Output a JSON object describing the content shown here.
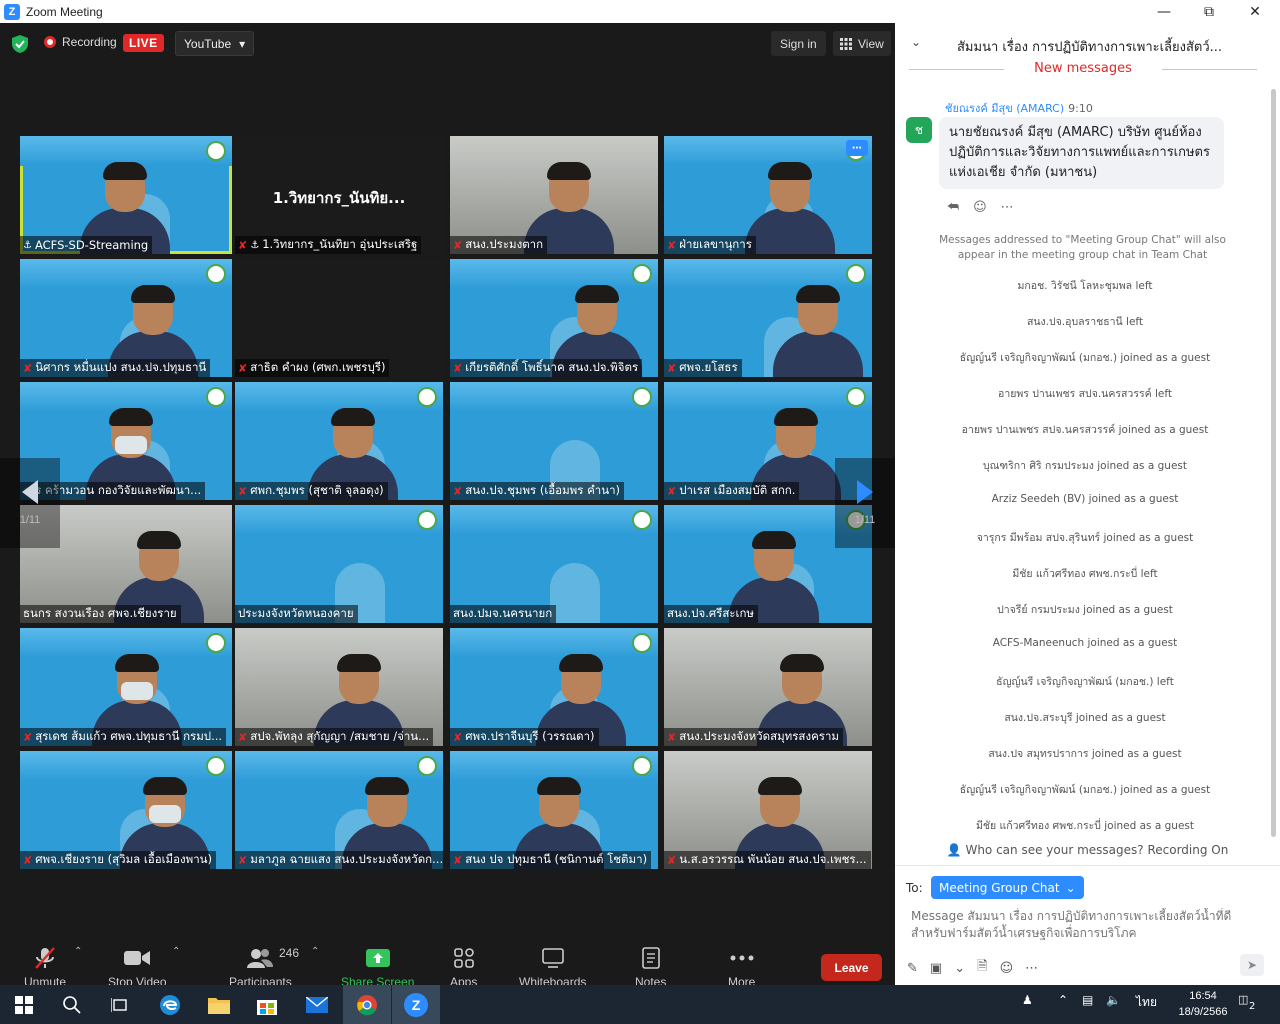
{
  "window": {
    "title": "Zoom Meeting"
  },
  "topbar": {
    "recording_label": "Recording",
    "live_label": "LIVE",
    "stream_target": "YouTube",
    "sign_in_label": "Sign in",
    "view_label": "View"
  },
  "gallery": {
    "page_left": "1/11",
    "page_right": "1/11",
    "tiles": [
      {
        "name": "ACFS-SD-Streaming",
        "muted": false,
        "pinned": true,
        "active": true,
        "kind": "slide"
      },
      {
        "name": "1.วิทยากร_นันทิยา อุ่นประเสริฐ",
        "display_name": "1.วิทยากร_นันทิย...",
        "muted": true,
        "pinned": true,
        "kind": "dark"
      },
      {
        "name": "สนง.ประมงตาก",
        "muted": true,
        "kind": "camera"
      },
      {
        "name": "ฝ่ายเลขานุการ",
        "muted": true,
        "kind": "slide"
      },
      {
        "name": "นิศากร หมื่นแปง สนง.ปจ.ปทุมธานี",
        "muted": true,
        "kind": "slide"
      },
      {
        "name": "สาธิต คำผง (ศพก.เพชรบุรี)",
        "muted": true,
        "kind": "dark"
      },
      {
        "name": "เกียรติศักดิ์ โพธิ์นาค สนง.ปจ.พิจิตร",
        "muted": true,
        "kind": "slide"
      },
      {
        "name": "ศพจ.ยโสธร",
        "muted": true,
        "kind": "slide"
      },
      {
        "name": "ร คร้ามวอน กองวิจัยและพัฒนา...",
        "muted": true,
        "kind": "slide"
      },
      {
        "name": "ศพก.ชุมพร (สุชาติ จุลอดุง)",
        "muted": true,
        "kind": "slide"
      },
      {
        "name": "สนง.ปจ.ชุมพร (เอื้อมพร คำนา)",
        "muted": true,
        "kind": "slide"
      },
      {
        "name": "ปาเรส เมืองสมบัติ สกก.",
        "muted": true,
        "kind": "slide"
      },
      {
        "name": "ธนกร สงวนเรือง ศพจ.เชียงราย",
        "muted": false,
        "kind": "camera"
      },
      {
        "name": "ประมงจังหวัดหนองคาย",
        "muted": false,
        "kind": "slide"
      },
      {
        "name": "สนง.ปมจ.นครนายก",
        "muted": false,
        "kind": "slide"
      },
      {
        "name": "สนง.ปจ.ศรีสะเกษ",
        "muted": false,
        "kind": "slide"
      },
      {
        "name": "สุรเดช ส้มแก้ว ศพจ.ปทุมธานี กรมป...",
        "muted": true,
        "kind": "slide"
      },
      {
        "name": "สปจ.พัทลุง สุกัญญา /สมชาย /จ่าน...",
        "muted": true,
        "kind": "camera"
      },
      {
        "name": "ศพจ.ปราจีนบุรี (วรรณดา)",
        "muted": true,
        "kind": "slide"
      },
      {
        "name": "สนง.ประมงจังหวัดสมุทรสงคราม",
        "muted": true,
        "kind": "camera"
      },
      {
        "name": "ศพจ.เชียงราย (สุวิมล เอื้อเมืองพาน)",
        "muted": true,
        "kind": "slide"
      },
      {
        "name": "มลาภูล ฉายแสง สนง.ประมงจังหวัดก...",
        "muted": true,
        "kind": "slide"
      },
      {
        "name": "สนง ปจ ปทุมธานี (ชนิกานต์ โชติมา)",
        "muted": true,
        "kind": "slide"
      },
      {
        "name": "น.ส.อรวรรณ พันน้อย สนง.ปจ.เพชร...",
        "muted": true,
        "kind": "camera"
      }
    ]
  },
  "toolbar": {
    "unmute": "Unmute",
    "stop_video": "Stop Video",
    "participants": "Participants",
    "participants_count": "246",
    "share_screen": "Share Screen",
    "apps": "Apps",
    "whiteboards": "Whiteboards",
    "notes": "Notes",
    "more": "More",
    "leave": "Leave"
  },
  "chat": {
    "title": "สัมมนา เรื่อง การปฏิบัติทางการเพาะเลี้ยงสัตว์...",
    "new_messages": "New messages",
    "message": {
      "sender": "ชัยณรงค์ มีสุข (AMARC)",
      "time": "9:10",
      "avatar_letter": "ช",
      "text": "นายชัยณรงค์ มีสุข (AMARC) บริษัท ศูนย์ห้องปฏิบัติการและวิจัยทางการแพทย์และการเกษตรแห่งเอเชีย จำกัด (มหาชน)"
    },
    "notice": "Messages addressed to \"Meeting Group Chat\" will also appear in the meeting group chat in Team Chat",
    "events": [
      "มกอช. วิรัชนี โลหะชุมพล left",
      "สนง.ปจ.อุบลราชธานี left",
      "ธัญญ์นรี เจริญกิจญาพัฒน์ (มกอช.) joined as a guest",
      "อายพร ปานเพชร สปจ.นครสวรรค์ left",
      "อายพร ปานเพชร สปจ.นครสวรรค์ joined as a guest",
      "บุณฑริกา ศิริ กรมประมง joined as a guest",
      "Arziz Seedeh (BV) joined as a guest",
      "จารุกร มีพร้อม สปจ.สุรินทร์ joined as a guest",
      "มีชัย แก้วศรีทอง ศพช.กระบี่ left",
      "ปาจรีย์ กรมประมง joined as a guest",
      "ACFS-Maneenuch joined as a guest",
      "ธัญญ์นรี เจริญกิจญาพัฒน์ (มกอช.) left",
      "สนง.ปจ.สระบุรี joined as a guest",
      "สนง.ปจ สมุทรปราการ joined as a guest",
      "ธัญญ์นรี เจริญกิจญาพัฒน์ (มกอช.) joined as a guest",
      "มีชัย แก้วศรีทอง ศพช.กระบี่ joined as a guest"
    ],
    "who_can_see": "Who can see your messages? Recording On",
    "to_label": "To:",
    "recipient": "Meeting Group Chat",
    "input_placeholder": "Message สัมมนา เรื่อง การปฏิบัติทางการเพาะเลี้ยงสัตว์น้ำที่ดีสำหรับฟาร์มสัตว์น้ำเศรษฐกิจเพื่อการบริโภค"
  },
  "taskbar": {
    "language": "ไทย",
    "time": "16:54",
    "date": "18/9/2566",
    "notifications": "2"
  },
  "colors": {
    "zoom_blue": "#2d8cff",
    "live_red": "#e02828",
    "share_green": "#35c35b",
    "leave_red": "#c4281c",
    "active_speaker": "#c9e336"
  }
}
